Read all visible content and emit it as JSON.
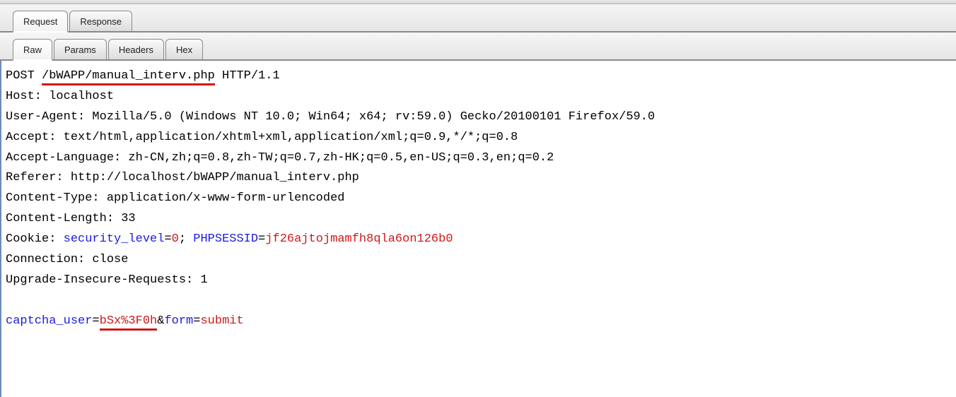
{
  "tabs": {
    "request": "Request",
    "response": "Response"
  },
  "subtabs": {
    "raw": "Raw",
    "params": "Params",
    "headers": "Headers",
    "hex": "Hex"
  },
  "req": {
    "method": "POST ",
    "path": "/bWAPP/manual_interv.php",
    "http": " HTTP/1.1",
    "host": "Host: localhost",
    "ua": "User-Agent: Mozilla/5.0 (Windows NT 10.0; Win64; x64; rv:59.0) Gecko/20100101 Firefox/59.0",
    "accept": "Accept: text/html,application/xhtml+xml,application/xml;q=0.9,*/*;q=0.8",
    "accept_lang": "Accept-Language: zh-CN,zh;q=0.8,zh-TW;q=0.7,zh-HK;q=0.5,en-US;q=0.3,en;q=0.2",
    "referer": "Referer: http://localhost/bWAPP/manual_interv.php",
    "ctype": "Content-Type: application/x-www-form-urlencoded",
    "clen": "Content-Length: 33",
    "cookie_label": "Cookie: ",
    "cookie_k1": "security_level",
    "cookie_eq1": "=",
    "cookie_v1": "0",
    "cookie_sep": "; ",
    "cookie_k2": "PHPSESSID",
    "cookie_eq2": "=",
    "cookie_v2": "jf26ajtojmamfh8qla6on126b0",
    "connection": "Connection: close",
    "upgrade": "Upgrade-Insecure-Requests: 1",
    "body_k1": "captcha_user",
    "body_eq1": "=",
    "body_v1": "bSx%3F0h",
    "body_amp": "&",
    "body_k2": "form",
    "body_eq2": "=",
    "body_v2": "submit"
  }
}
